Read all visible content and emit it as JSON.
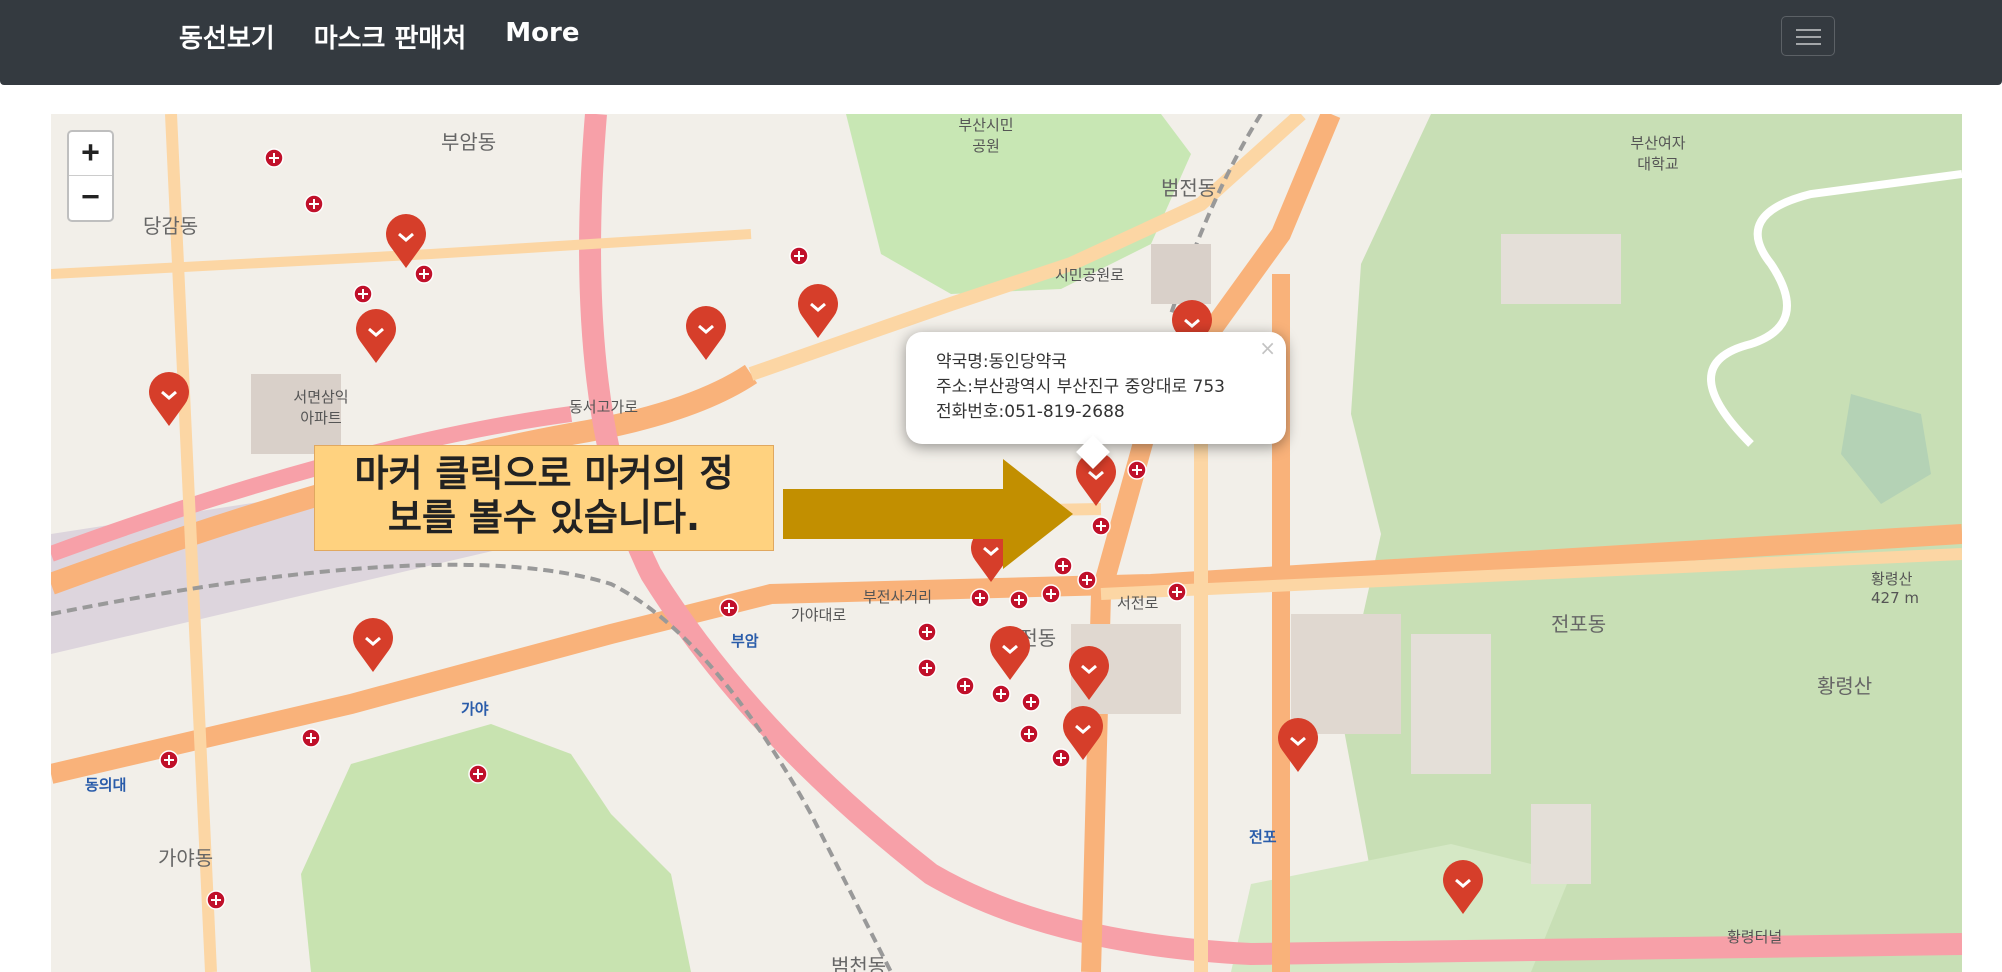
{
  "navbar": {
    "links": [
      "동선보기",
      "마스크 판매처",
      "More"
    ],
    "toggler_icon": "hamburger-icon"
  },
  "map": {
    "zoom_in": "+",
    "zoom_out": "−",
    "popup": {
      "name_line": "약국명:동인당약국",
      "address_line": "주소:부산광역시 부산진구 중앙대로 753",
      "phone_line": "전화번호:051-819-2688",
      "close": "×"
    },
    "callout": {
      "line1": "마커 클릭으로 마커의 정",
      "line2": "보를 볼수 있습니다."
    },
    "labels": {
      "bujeon_dong": "부전동",
      "jeonpo_dong": "전포동",
      "danggam_dong": "당감동",
      "buam_dong": "부암동",
      "beomjeon_dong": "범전동",
      "gaya_dong": "가야동",
      "hwangnyeongsan": "황령산",
      "seomyeon_apt": "서면삼익 아파트",
      "busan_citizens_park": "부산시민 공원",
      "busan_girls_college": "부산여자 대학교",
      "dongeui_univ": "동의대",
      "gaya_station": "가야",
      "bueom_station": "부암",
      "jeonpo_station": "전포",
      "hwangnyeong_tunnel": "황령터널",
      "seojeonro": "서전로",
      "bujeon_sageori": "부전사거리",
      "gaya_daero": "가야대로",
      "dongseo_gogaro": "동서고가로",
      "simin_gongwonro": "시민공원로",
      "beomcheon_dong": "범천동",
      "hwangnyeongsan_height": "황령산 427 m"
    },
    "accent_colors": {
      "marker_red": "#d63e2a",
      "road_orange": "#f9b27a",
      "park_green": "#add19e",
      "arrow_gold": "#c28f00"
    }
  }
}
